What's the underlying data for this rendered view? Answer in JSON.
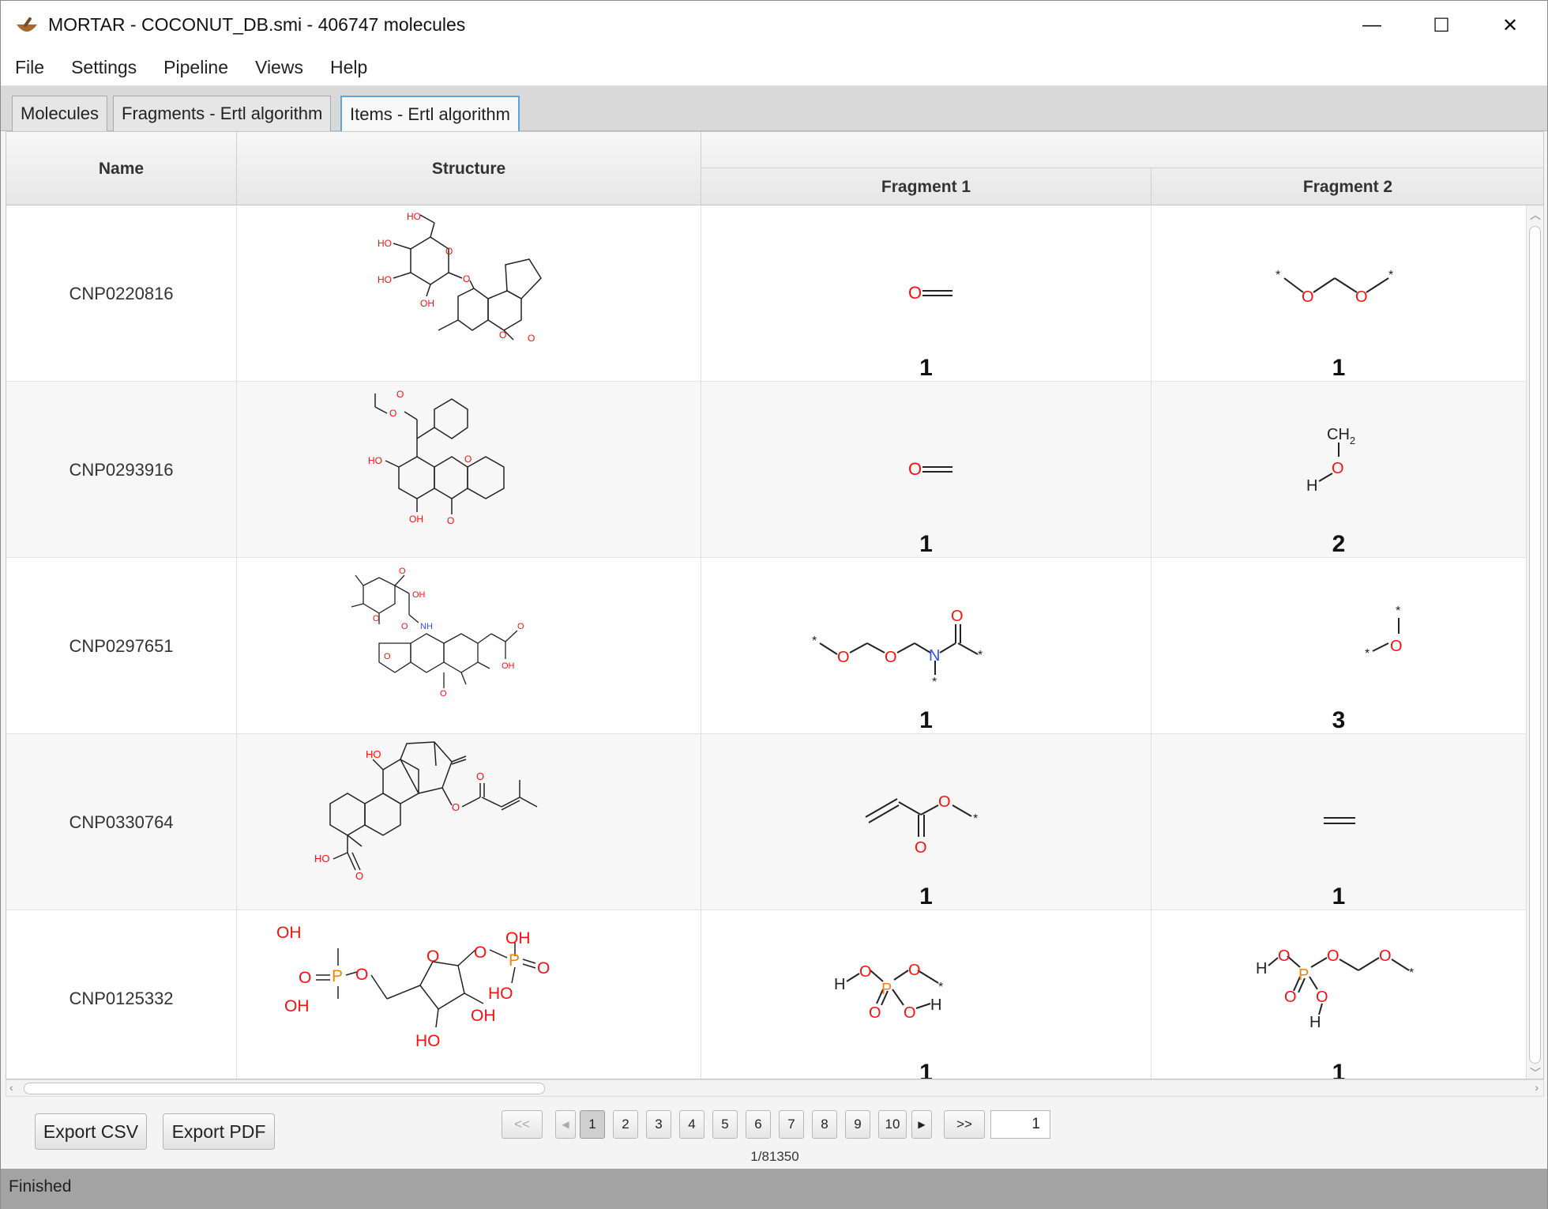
{
  "window": {
    "title": "MORTAR - COCONUT_DB.smi - 406747 molecules",
    "minimize": "—",
    "maximize": "☐",
    "close": "✕"
  },
  "menu": [
    "File",
    "Settings",
    "Pipeline",
    "Views",
    "Help"
  ],
  "tabs": [
    "Molecules",
    "Fragments - Ertl algorithm",
    "Items - Ertl algorithm"
  ],
  "table": {
    "headers": {
      "name": "Name",
      "structure": "Structure",
      "fragment1": "Fragment 1",
      "fragment2": "Fragment 2"
    },
    "rows": [
      {
        "name": "CNP0220816",
        "frag1_count": "1",
        "frag2_count": "1"
      },
      {
        "name": "CNP0293916",
        "frag1_count": "1",
        "frag2_count": "2"
      },
      {
        "name": "CNP0297651",
        "frag1_count": "1",
        "frag2_count": "3"
      },
      {
        "name": "CNP0330764",
        "frag1_count": "1",
        "frag2_count": "1"
      },
      {
        "name": "CNP0125332",
        "frag1_count": "1",
        "frag2_count": "1"
      }
    ]
  },
  "atoms": {
    "ho": "HO",
    "oh": "OH",
    "o": "O",
    "n": "N",
    "nh": "NH",
    "p": "P",
    "h": "H",
    "star": "*",
    "ch2": "CH",
    "sub2": "2"
  },
  "footer": {
    "export_csv": "Export CSV",
    "export_pdf": "Export PDF",
    "first": "<<",
    "prev": "◀",
    "pages": [
      "1",
      "2",
      "3",
      "4",
      "5",
      "6",
      "7",
      "8",
      "9",
      "10"
    ],
    "next": "▶",
    "last": ">>",
    "page_input": "1",
    "page_info": "1/81350"
  },
  "status": "Finished",
  "colors": {
    "oxygen": "#ff0d0d",
    "nitrogen": "#3050f8",
    "phosphorus": "#ff8000",
    "tab_active_border": "#5aa6da"
  }
}
